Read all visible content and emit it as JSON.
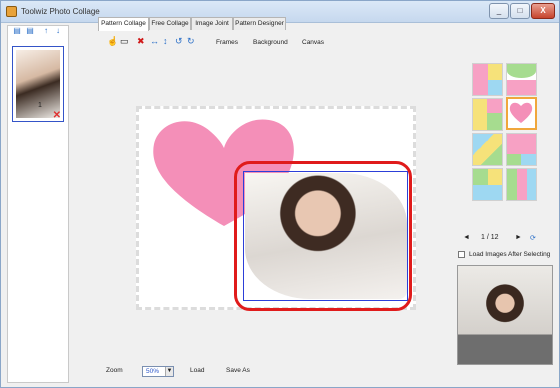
{
  "window": {
    "title": "Toolwiz Photo Collage",
    "min": "_",
    "max": "□",
    "close": "X"
  },
  "left_panel": {
    "tools": [
      {
        "icon": "add-photo-icon",
        "glyph": "▤"
      },
      {
        "icon": "remove-photo-icon",
        "glyph": "▤"
      },
      {
        "icon": "move-up-icon",
        "glyph": "↑"
      },
      {
        "icon": "move-down-icon",
        "glyph": "↓"
      }
    ],
    "thumbnail": {
      "number": "1",
      "delete": "✕"
    }
  },
  "tabs": [
    "Pattern Collage",
    "Free Collage",
    "Image Joint",
    "Pattern Designer"
  ],
  "toolbar": {
    "icons": [
      "pointer-icon",
      "image-icon",
      "delete-icon",
      "flip-horizontal-icon",
      "flip-vertical-icon",
      "rotate-left-icon",
      "rotate-right-icon"
    ],
    "glyphs": [
      "☝",
      "▭",
      "✖",
      "↔",
      "↕",
      "↺",
      "↻"
    ],
    "frames": "Frames",
    "background": "Background",
    "canvas": "Canvas"
  },
  "bottom": {
    "zoom_label": "Zoom",
    "zoom_value": "50%",
    "load": "Load",
    "save_as": "Save As"
  },
  "templates": {
    "pager_prev": "◄",
    "page": "1 / 12",
    "pager_next": "►",
    "refresh": "⟳",
    "load_after": "Load Images After Selecting"
  },
  "colors": {
    "accent_red": "#e01b1b",
    "selection_blue": "#2c3fd8",
    "heart_pink": "#f48fb8"
  }
}
